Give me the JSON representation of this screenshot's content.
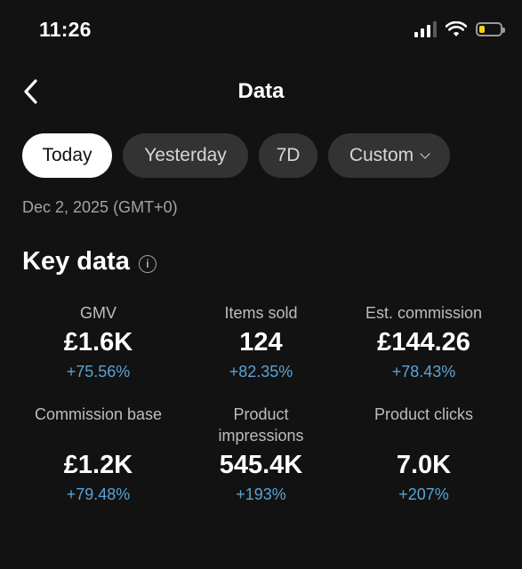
{
  "status_bar": {
    "time": "11:26",
    "battery_level": 0.25,
    "battery_color": "#f5d21a"
  },
  "header": {
    "title": "Data",
    "back_icon": "chevron-left-icon"
  },
  "tabs": [
    {
      "label": "Today",
      "active": true
    },
    {
      "label": "Yesterday",
      "active": false
    },
    {
      "label": "7D",
      "active": false
    },
    {
      "label": "Custom",
      "active": false,
      "icon": "chevron-down-icon"
    }
  ],
  "date_label": "Dec 2, 2025 (GMT+0)",
  "key_data": {
    "title": "Key data",
    "info_icon": "info-icon",
    "change_color": "#5aa3d4",
    "metrics": [
      {
        "label": "GMV",
        "value": "£1.6K",
        "change": "+75.56%"
      },
      {
        "label": "Items sold",
        "value": "124",
        "change": "+82.35%"
      },
      {
        "label": "Est. commission",
        "value": "£144.26",
        "change": "+78.43%"
      },
      {
        "label": "Commission base",
        "value": "£1.2K",
        "change": "+79.48%"
      },
      {
        "label": "Product impressions",
        "value": "545.4K",
        "change": "+193%"
      },
      {
        "label": "Product clicks",
        "value": "7.0K",
        "change": "+207%"
      }
    ]
  }
}
